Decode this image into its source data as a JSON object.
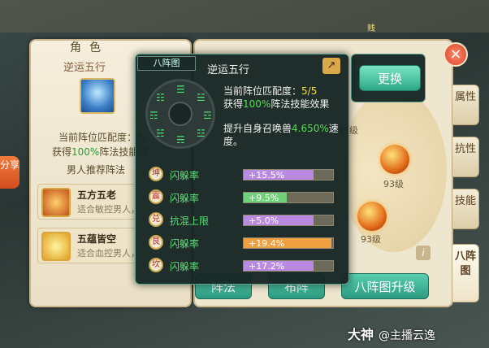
{
  "top_marker": "贱",
  "share": {
    "label": "分享"
  },
  "character_panel": {
    "header": "角色",
    "combo_title": "逆运五行",
    "match_label": "当前阵位匹配度：5/",
    "gain_prefix": "获得",
    "gain_value": "100%",
    "gain_suffix": "阵法技能效",
    "recommend_title": "男人推荐阵法",
    "recommendations": [
      {
        "name": "五方五老",
        "desc": "适合敏控男人，"
      },
      {
        "name": "五蕴皆空",
        "desc": "适合血控男人，"
      }
    ]
  },
  "popup": {
    "tag": "八阵图",
    "title": "逆运五行",
    "match_prefix": "当前阵位匹配度：",
    "match_value": "5/5",
    "gain_prefix": "获得",
    "gain_value": "100%",
    "gain_suffix": "阵法技能效果",
    "boost_prefix": "提升自身召唤兽",
    "boost_value": "4.650%",
    "boost_suffix": "速",
    "boost_line2": "度。",
    "stats": [
      {
        "seal": "坤",
        "label": "闪躲率",
        "value": "+15.5%",
        "fill": 0.78,
        "color": "#b98ae0"
      },
      {
        "seal": "震",
        "label": "闪躲率",
        "value": "+9.5%",
        "fill": 0.48,
        "color": "#6fd17a"
      },
      {
        "seal": "兑",
        "label": "抗混上限",
        "value": "+5.0%",
        "fill": 0.78,
        "color": "#b98ae0"
      },
      {
        "seal": "艮",
        "label": "闪躲率",
        "value": "+19.4%",
        "fill": 0.98,
        "color": "#f0a040"
      },
      {
        "seal": "坎",
        "label": "闪躲率",
        "value": "+17.2%",
        "fill": 0.78,
        "color": "#b98ae0"
      }
    ]
  },
  "replace_button": "更换",
  "levels": [
    "93级",
    "93级",
    "93级"
  ],
  "side_tabs": [
    "属性",
    "抗性",
    "技能",
    "八阵图"
  ],
  "bottom_buttons": [
    "阵法",
    "布阵",
    "八阵图升级"
  ],
  "watermark": {
    "brand": "大神",
    "handle": "@主播云逸"
  },
  "colors": {
    "accent_green": "#2ea886",
    "highlight_green": "#55dd55",
    "highlight_yellow": "#f2e04a"
  }
}
